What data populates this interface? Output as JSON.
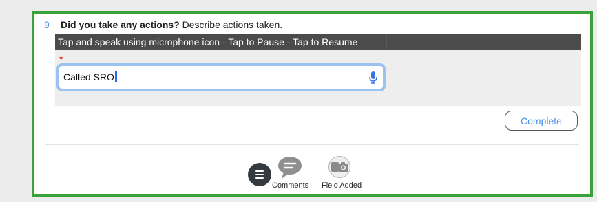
{
  "question": {
    "number": "9",
    "title": "Did you take any actions?",
    "description": "Describe actions taken."
  },
  "hint": {
    "text": "Tap and speak using microphone icon - Tap to Pause - Tap to Resume"
  },
  "field": {
    "required_marker": "*",
    "value": "Called SRO"
  },
  "buttons": {
    "complete": "Complete"
  },
  "toolbar": {
    "comments_label": "Comments",
    "field_added_label": "Field Added"
  },
  "colors": {
    "frame_border": "#3aa23a",
    "accent_blue": "#4a90e2",
    "input_focus_border": "#9cc2f2",
    "hint_bar": "#4b4b4b",
    "required": "#e02020"
  },
  "icons": [
    "menu-icon",
    "comment-icon",
    "camera-icon",
    "microphone-icon"
  ]
}
